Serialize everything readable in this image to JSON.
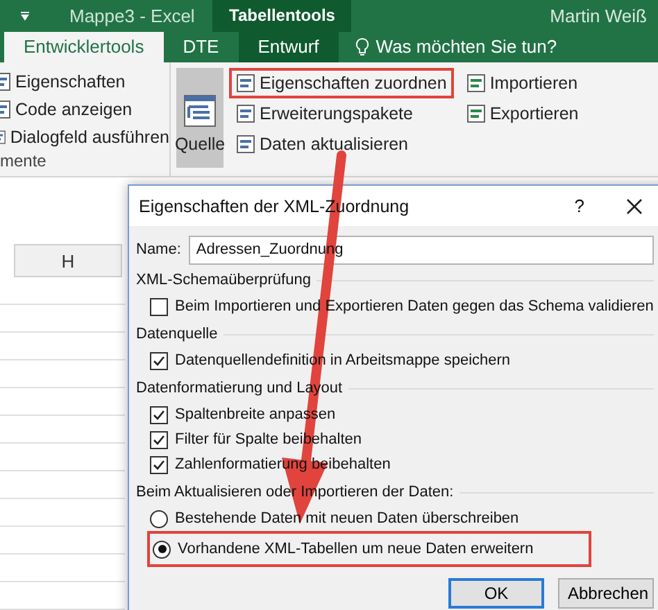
{
  "title_bar": {
    "document": "Mappe3  -  Excel",
    "context_tab": "Tabellentools",
    "user": "Martin Weiß"
  },
  "ribbon_tabs": [
    {
      "label": "Entwicklertools",
      "selected": true,
      "contextual": false
    },
    {
      "label": "DTE",
      "selected": false,
      "contextual": false
    },
    {
      "label": "Entwurf",
      "selected": false,
      "contextual": true
    }
  ],
  "tell_me": "Was möchten Sie tun?",
  "ribbon": {
    "controls": [
      "Eigenschaften",
      "Code anzeigen",
      "Dialogfeld ausführen"
    ],
    "controls_group_label": "mente",
    "source_button": {
      "label": "Quelle",
      "pressed": true
    },
    "xml_commands": [
      {
        "label": "Eigenschaften zuordnen",
        "highlighted": true
      },
      {
        "label": "Erweiterungspakete",
        "highlighted": false
      },
      {
        "label": "Daten aktualisieren",
        "highlighted": false
      }
    ],
    "xml_io": [
      "Importieren",
      "Exportieren"
    ]
  },
  "sheet": {
    "column_header": "H"
  },
  "dialog": {
    "title": "Eigenschaften der XML-Zuordnung",
    "help": "?",
    "name_label": "Name:",
    "name_value": "Adressen_Zuordnung",
    "sections": [
      {
        "heading": "XML-Schemaüberprüfung",
        "options": [
          {
            "kind": "checkbox",
            "label": "Beim Importieren und Exportieren Daten gegen das Schema validieren",
            "checked": false,
            "highlighted": false
          }
        ]
      },
      {
        "heading": "Datenquelle",
        "options": [
          {
            "kind": "checkbox",
            "label": "Datenquellendefinition in Arbeitsmappe speichern",
            "checked": true,
            "highlighted": false
          }
        ]
      },
      {
        "heading": "Datenformatierung und Layout",
        "options": [
          {
            "kind": "checkbox",
            "label": "Spaltenbreite anpassen",
            "checked": true,
            "highlighted": false
          },
          {
            "kind": "checkbox",
            "label": "Filter für Spalte beibehalten",
            "checked": true,
            "highlighted": false
          },
          {
            "kind": "checkbox",
            "label": "Zahlenformatierung beibehalten",
            "checked": true,
            "highlighted": false
          }
        ]
      },
      {
        "heading": "Beim Aktualisieren oder Importieren der Daten:",
        "options": [
          {
            "kind": "radio",
            "label": "Bestehende Daten mit neuen Daten überschreiben",
            "checked": false,
            "highlighted": false
          },
          {
            "kind": "radio",
            "label": "Vorhandene XML-Tabellen um neue Daten erweitern",
            "checked": true,
            "highlighted": true
          }
        ]
      }
    ],
    "buttons": [
      {
        "label": "OK",
        "default": true
      },
      {
        "label": "Abbrechen",
        "default": false
      }
    ]
  }
}
